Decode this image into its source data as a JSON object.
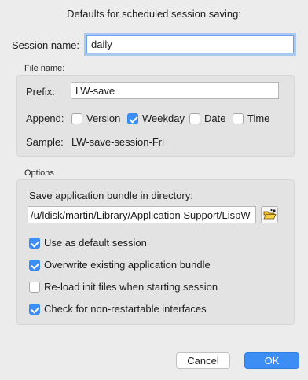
{
  "dialog": {
    "title": "Defaults for scheduled session saving:"
  },
  "session_name": {
    "label": "Session name:",
    "value": "daily"
  },
  "file_name_group": {
    "caption": "File name:",
    "prefix_label": "Prefix:",
    "prefix_value": "LW-save",
    "append_label": "Append:",
    "append_options": [
      {
        "label": "Version",
        "checked": false
      },
      {
        "label": "Weekday",
        "checked": true
      },
      {
        "label": "Date",
        "checked": false
      },
      {
        "label": "Time",
        "checked": false
      }
    ],
    "sample_label": "Sample:",
    "sample_value": "LW-save-session-Fri"
  },
  "options_group": {
    "caption": "Options",
    "dir_label": "Save application bundle in directory:",
    "dir_value": "/u/ldisk/martin/Library/Application Support/LispWorks/",
    "browse_icon": "folder-open-icon",
    "checkboxes": [
      {
        "label": "Use as default session",
        "checked": true
      },
      {
        "label": "Overwrite existing application bundle",
        "checked": true
      },
      {
        "label": "Re-load init files when starting session",
        "checked": false
      },
      {
        "label": "Check for non-restartable interfaces",
        "checked": true
      }
    ]
  },
  "buttons": {
    "cancel_label": "Cancel",
    "ok_label": "OK"
  },
  "colors": {
    "accent": "#3c8df4",
    "focus_ring": "#a9c9f1",
    "window_bg": "#ececec"
  }
}
